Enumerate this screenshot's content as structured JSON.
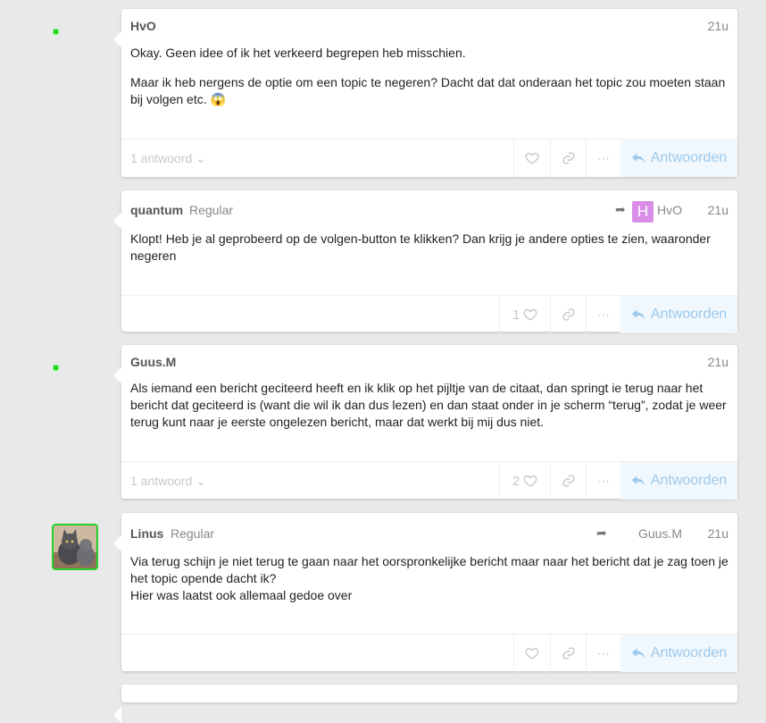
{
  "posts": [
    {
      "user": "HvO",
      "title": "",
      "date": "21u",
      "paragraphs": [
        "Okay. Geen idee of ik het verkeerd begrepen heb misschien.",
        "Maar ik heb nergens de optie om een topic te negeren? Dacht dat dat onderaan het topic zou moeten staan bij volgen etc. 😱"
      ],
      "replies_label": "1 antwoord",
      "likes": "",
      "reply_label": "Antwoorden"
    },
    {
      "user": "quantum",
      "title": "Regular",
      "reply_to": "HvO",
      "reply_to_badge": "H",
      "date": "21u",
      "paragraphs": [
        "Klopt! Heb je al geprobeerd op de volgen-button te klikken? Dan krijg je andere opties te zien, waaronder negeren"
      ],
      "replies_label": "",
      "likes": "1",
      "reply_label": "Antwoorden"
    },
    {
      "user": "Guus.M",
      "title": "",
      "date": "21u",
      "paragraphs": [
        "Als iemand een bericht geciteerd heeft en ik klik op het pijltje van de citaat, dan springt ie terug naar het bericht dat geciteerd is (want die wil ik dan dus lezen) en dan staat onder in je scherm “terug”, zodat je weer terug kunt naar je eerste ongelezen bericht, maar dat werkt bij mij dus niet."
      ],
      "replies_label": "1 antwoord",
      "likes": "2",
      "reply_label": "Antwoorden"
    },
    {
      "user": "Linus",
      "title": "Regular",
      "reply_to": "Guus.M",
      "date": "21u",
      "paragraphs": [
        "Via terug schijn je niet terug te gaan naar het oorspronkelijke bericht maar naar het bericht dat je zag toen je het topic opende dacht ik?",
        "Hier was laatst ook allemaal gedoe over"
      ],
      "replies_label": "",
      "likes": "",
      "reply_label": "Antwoorden"
    }
  ],
  "colors": {
    "accent": "#9cc8ec",
    "online": "#2bd12b",
    "badge": "#d98ee8"
  },
  "icons": {
    "like": "heart-icon",
    "link": "link-icon",
    "more": "ellipsis-icon",
    "reply": "reply-arrow-icon",
    "share": "share-arrow-icon"
  }
}
